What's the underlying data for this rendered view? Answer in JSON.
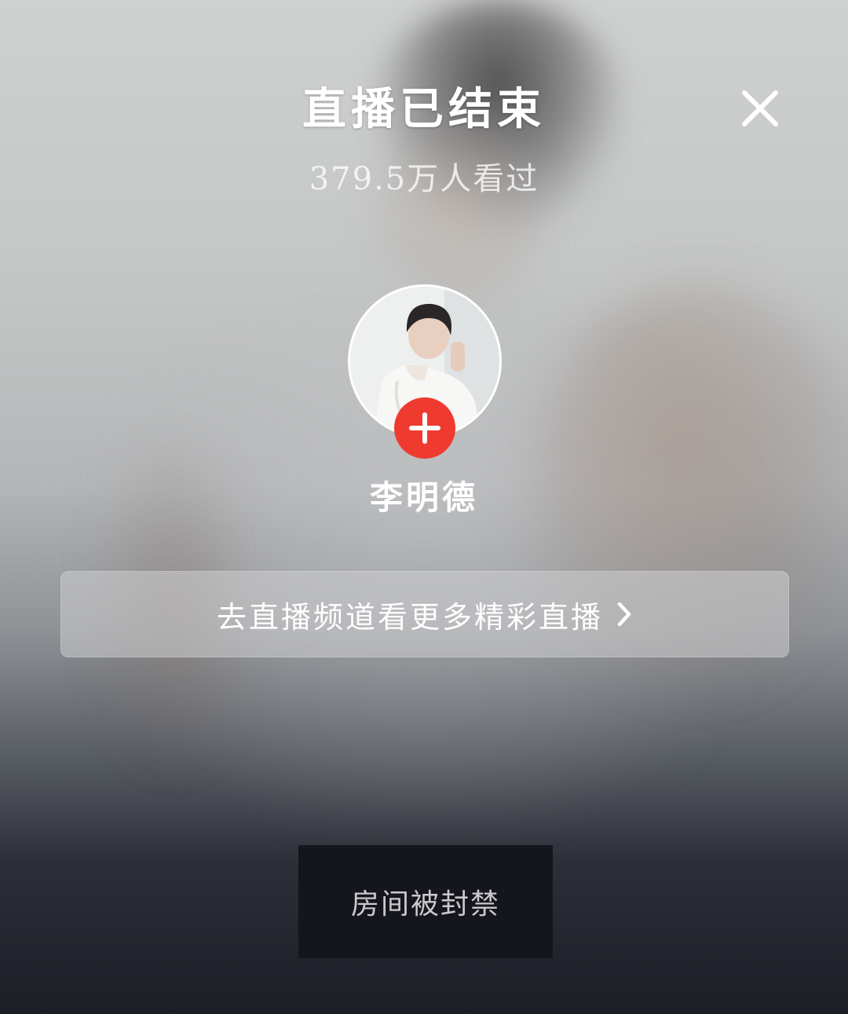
{
  "header": {
    "title": "直播已结束",
    "close_icon": "close-icon"
  },
  "stats": {
    "viewers_text": "379.5万人看过"
  },
  "streamer": {
    "name": "李明德",
    "avatar_icon": "avatar-photo",
    "follow_icon": "plus-icon"
  },
  "channel_link": {
    "label": "去直播频道看更多精彩直播",
    "chevron_icon": "chevron-right-icon"
  },
  "notice": {
    "text": "房间被封禁"
  },
  "colors": {
    "follow_red": "#ef3b2f",
    "notice_bg": "#15161d",
    "notice_text": "#c9c9cc"
  }
}
